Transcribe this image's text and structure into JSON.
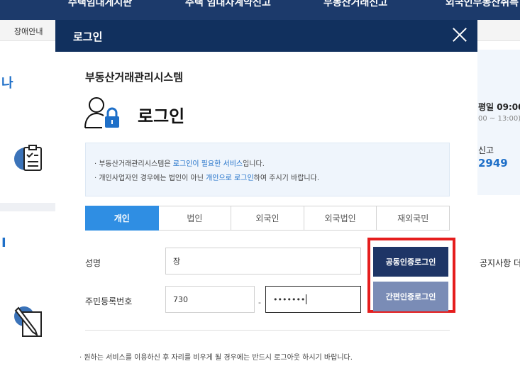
{
  "background": {
    "nav_items": [
      "수택임대게시판",
      "주택 임대차계약신고",
      "부동산거래신고",
      "외국인부동산취득"
    ],
    "subbar_text": "장애안내",
    "right_panel": {
      "hours_text": "평일 09:00",
      "hours_sub": "00 ~ 13:00)",
      "stat_label": "신고",
      "stat_value": "2949",
      "notice_text": "공지사항 더"
    },
    "left_letters": [
      "나",
      "I"
    ]
  },
  "modal": {
    "title": "로그인",
    "system_name": "부동산거래관리시스템",
    "heading": "로그인",
    "notices": [
      {
        "pre": "· 부동산거래관리시스템은 ",
        "hl": "로그인이 필요한 서비스",
        "post": "입니다."
      },
      {
        "pre": "· 개인사업자인 경우에는 법인이 아닌 ",
        "hl": "개인으로 로그인",
        "post": "하여 주시기 바랍니다."
      }
    ],
    "tabs": [
      "개인",
      "법인",
      "외국인",
      "외국법인",
      "재외국민"
    ],
    "active_tab": "개인",
    "form": {
      "name_label": "성명",
      "name_value": "장",
      "rrn_label": "주민등록번호",
      "rrn_front": "730",
      "rrn_separator": "-",
      "rrn_back": "•••••••"
    },
    "buttons": {
      "joint_cert": "공동인증로그인",
      "simple_cert": "간편인증로그인"
    },
    "bottom_notice": "· 원하는 서비스를 이용하신 후 자리를 비우게 될 경우에는 반드시 로그아웃 하시기 바랍니다."
  },
  "colors": {
    "nav_bg": "#1c3a6b",
    "modal_header": "#11305e",
    "active_tab": "#2f8ee3",
    "joint_btn": "#1e3566",
    "simple_btn": "#7a8cb6",
    "highlight": "#e51d1d"
  }
}
